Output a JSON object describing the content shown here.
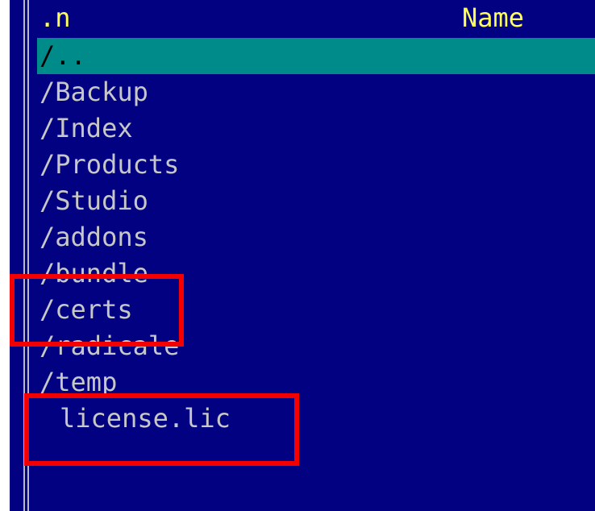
{
  "header": {
    "sort_indicator": ".n",
    "column_name": "Name"
  },
  "entries": [
    {
      "name": "/..",
      "type": "dir",
      "selected": true
    },
    {
      "name": "/Backup",
      "type": "dir"
    },
    {
      "name": "/Index",
      "type": "dir"
    },
    {
      "name": "/Products",
      "type": "dir"
    },
    {
      "name": "/Studio",
      "type": "dir"
    },
    {
      "name": "/addons",
      "type": "dir"
    },
    {
      "name": "/bundle",
      "type": "dir"
    },
    {
      "name": "/certs",
      "type": "dir",
      "highlighted": true
    },
    {
      "name": "/radicale",
      "type": "dir"
    },
    {
      "name": "/temp",
      "type": "dir"
    },
    {
      "name": "license.lic",
      "type": "file",
      "highlighted": true
    }
  ],
  "colors": {
    "panel_background": "#010182",
    "header_text": "#ffff54",
    "entry_text": "#c7c7c7",
    "selection_bar": "#008b8b",
    "annotation_box": "#f50000"
  }
}
